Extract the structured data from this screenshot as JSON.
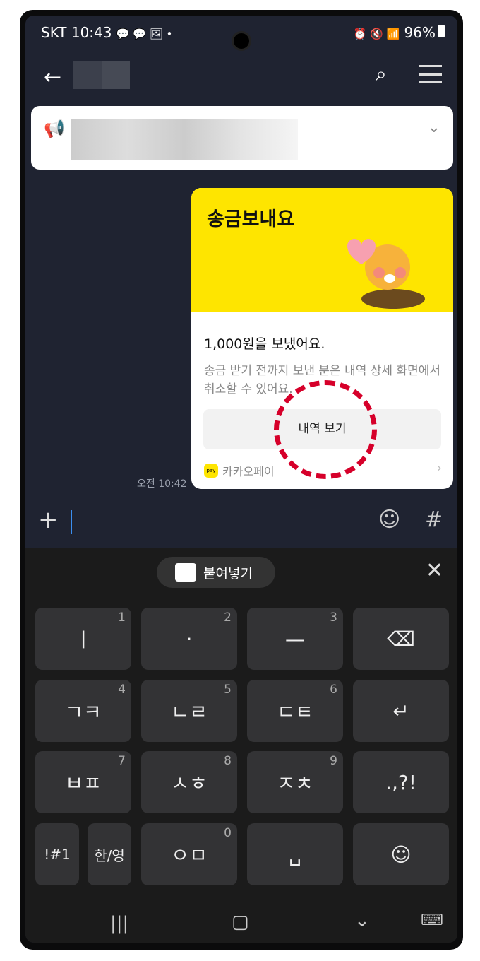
{
  "status": {
    "carrier": "SKT",
    "time": "10:43",
    "notif_icons": "💬 💬 🖼 •",
    "right_icons": "⏰ 🔇 📶",
    "battery": "96%"
  },
  "header": {
    "back": "←",
    "search": "⌕"
  },
  "notice": {
    "icon": "megaphone-icon",
    "chevron": "⌄"
  },
  "card": {
    "title": "송금보내요",
    "amount_text": "1,000원을 보냈어요.",
    "description": "송금 받기 전까지 보낸 분은 내역 상세 화면에서 취소할 수 있어요.",
    "button": "내역 보기",
    "provider": "카카오페이",
    "pay_icon": "pay",
    "chevron": "›",
    "time": "오전 10:42"
  },
  "colors": {
    "accent": "#fee500",
    "highlight": "#d6002a",
    "bg": "#1f2331"
  },
  "input": {
    "plus": "+",
    "emoji": "☺",
    "hash": "#"
  },
  "keyboard": {
    "paste": "붙여넣기",
    "close": "✕",
    "keys": [
      {
        "label": "ㅣ",
        "num": "1"
      },
      {
        "label": "·",
        "num": "2"
      },
      {
        "label": "—",
        "num": "3"
      },
      {
        "label": "⌫",
        "num": ""
      },
      {
        "label": "ㄱㅋ",
        "num": "4"
      },
      {
        "label": "ㄴㄹ",
        "num": "5"
      },
      {
        "label": "ㄷㅌ",
        "num": "6"
      },
      {
        "label": "↵",
        "num": ""
      },
      {
        "label": "ㅂㅍ",
        "num": "7"
      },
      {
        "label": "ㅅㅎ",
        "num": "8"
      },
      {
        "label": "ㅈㅊ",
        "num": "9"
      },
      {
        "label": ".,?!",
        "num": ""
      },
      {
        "label": "!#1",
        "num": ""
      },
      {
        "label": "한/영",
        "num": ""
      },
      {
        "label": "ㅇㅁ",
        "num": "0"
      },
      {
        "label": "␣",
        "num": ""
      },
      {
        "label": "☺",
        "num": ""
      }
    ]
  },
  "navbar": {
    "recent": "|||",
    "home": "▢",
    "back": "⌄",
    "keyboard": "⌨"
  }
}
